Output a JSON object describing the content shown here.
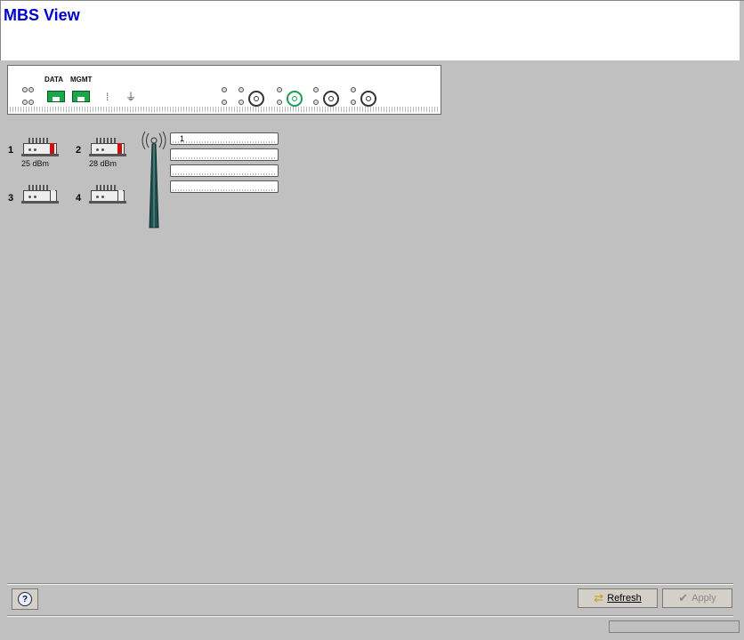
{
  "header": {
    "title": "MBS View"
  },
  "chassis": {
    "ports": {
      "data_label": "DATA",
      "mgmt_label": "MGMT"
    }
  },
  "radios": [
    {
      "number": "1",
      "power": "25 dBm",
      "active": true
    },
    {
      "number": "2",
      "power": "28 dBm",
      "active": true
    },
    {
      "number": "3",
      "power": "",
      "active": false
    },
    {
      "number": "4",
      "power": "",
      "active": false
    }
  ],
  "antenna": {
    "fields": [
      "1",
      "",
      "",
      ""
    ]
  },
  "footer": {
    "help_icon": "question-icon",
    "refresh_label": "Refresh",
    "apply_label": "Apply"
  },
  "colors": {
    "title": "#0000cc",
    "background": "#c0c0c0",
    "power_bar": "#cc1111",
    "ethernet": "#17a84a"
  }
}
